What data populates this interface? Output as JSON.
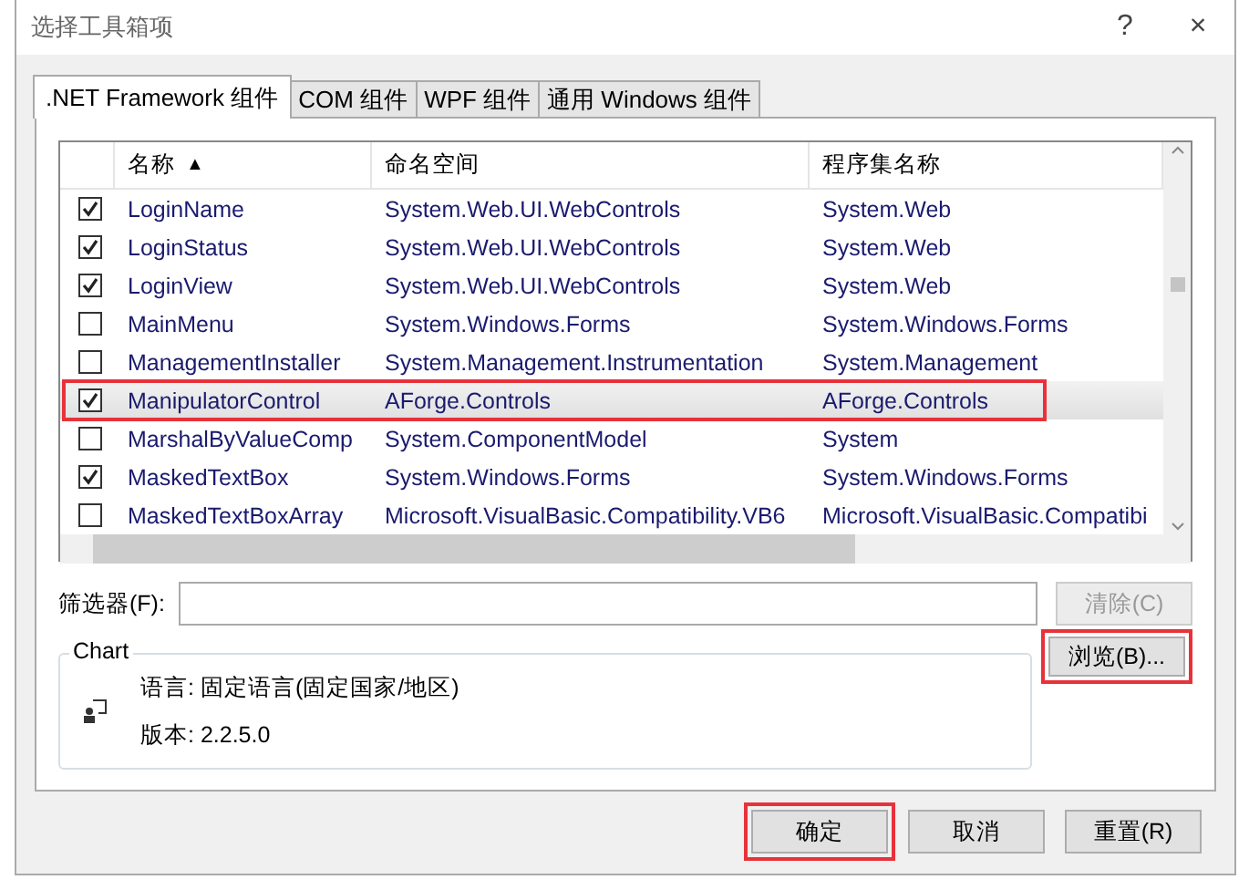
{
  "window": {
    "title": "选择工具箱项",
    "help": "?",
    "close": "×"
  },
  "tabs": [
    {
      "label": ".NET Framework 组件",
      "selected": true
    },
    {
      "label": "COM 组件",
      "selected": false
    },
    {
      "label": "WPF 组件",
      "selected": false
    },
    {
      "label": "通用 Windows 组件",
      "selected": false
    }
  ],
  "table": {
    "columns": [
      "名称",
      "命名空间",
      "程序集名称"
    ],
    "sort_arrow": "▲",
    "rows": [
      {
        "checked": true,
        "selected": false,
        "highlighted": false,
        "cells": [
          "LoginName",
          "System.Web.UI.WebControls",
          "System.Web"
        ]
      },
      {
        "checked": true,
        "selected": false,
        "highlighted": false,
        "cells": [
          "LoginStatus",
          "System.Web.UI.WebControls",
          "System.Web"
        ]
      },
      {
        "checked": true,
        "selected": false,
        "highlighted": false,
        "cells": [
          "LoginView",
          "System.Web.UI.WebControls",
          "System.Web"
        ]
      },
      {
        "checked": false,
        "selected": false,
        "highlighted": false,
        "cells": [
          "MainMenu",
          "System.Windows.Forms",
          "System.Windows.Forms"
        ]
      },
      {
        "checked": false,
        "selected": false,
        "highlighted": false,
        "cells": [
          "ManagementInstaller",
          "System.Management.Instrumentation",
          "System.Management"
        ]
      },
      {
        "checked": true,
        "selected": true,
        "highlighted": true,
        "cells": [
          "ManipulatorControl",
          "AForge.Controls",
          "AForge.Controls"
        ]
      },
      {
        "checked": false,
        "selected": false,
        "highlighted": false,
        "cells": [
          "MarshalByValueComp",
          "System.ComponentModel",
          "System"
        ]
      },
      {
        "checked": true,
        "selected": false,
        "highlighted": false,
        "cells": [
          "MaskedTextBox",
          "System.Windows.Forms",
          "System.Windows.Forms"
        ]
      },
      {
        "checked": false,
        "selected": false,
        "highlighted": false,
        "cells": [
          "MaskedTextBoxArray",
          "Microsoft.VisualBasic.Compatibility.VB6",
          "Microsoft.VisualBasic.Compatibi"
        ]
      }
    ]
  },
  "filter": {
    "label": "筛选器(F):",
    "clear_button": {
      "label": "清除(C)",
      "disabled": true
    }
  },
  "details": {
    "title": "Chart",
    "language": "语言: 固定语言(固定国家/地区)",
    "version": "版本: 2.2.5.0"
  },
  "browse_button": {
    "label": "浏览(B)...",
    "highlighted": true
  },
  "buttons": [
    {
      "label": "确定",
      "highlighted": true
    },
    {
      "label": "取消",
      "highlighted": false
    },
    {
      "label": "重置(R)",
      "highlighted": false
    }
  ]
}
